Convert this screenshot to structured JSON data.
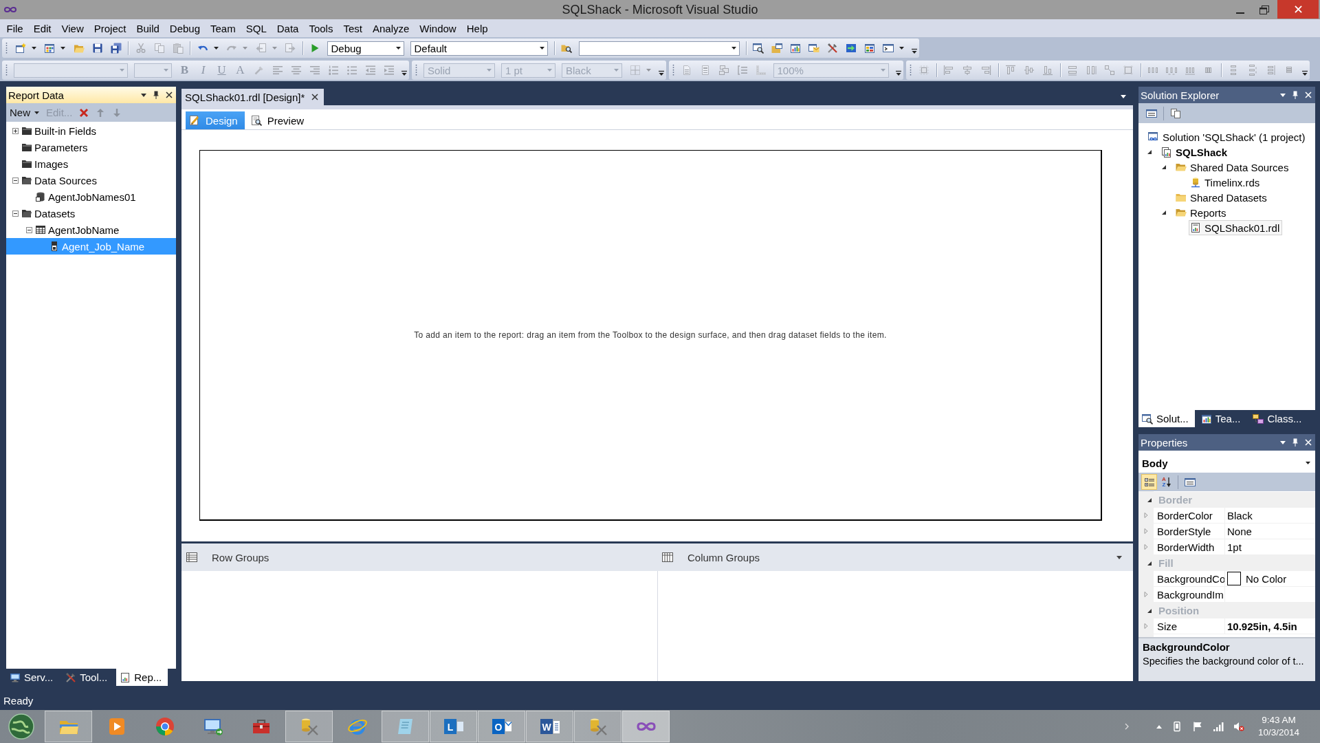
{
  "window": {
    "title": "SQLShack - Microsoft Visual Studio"
  },
  "menu": [
    "File",
    "Edit",
    "View",
    "Project",
    "Build",
    "Debug",
    "Team",
    "SQL",
    "Data",
    "Tools",
    "Test",
    "Analyze",
    "Window",
    "Help"
  ],
  "toolbar_rows": [
    [
      {
        "groups": [
          [
            {
              "kind": "split",
              "disabled": false
            },
            {
              "kind": "split",
              "disabled": false
            },
            {
              "kind": "button",
              "disabled": false
            },
            {
              "kind": "button",
              "disabled": false
            },
            {
              "kind": "button",
              "disabled": false
            }
          ],
          [
            {
              "kind": "button",
              "disabled": true
            },
            {
              "kind": "button",
              "disabled": true
            },
            {
              "kind": "button",
              "disabled": true
            }
          ],
          [
            {
              "kind": "split",
              "disabled": false
            },
            {
              "kind": "split",
              "disabled": true
            },
            {
              "kind": "split",
              "disabled": true
            },
            {
              "kind": "button",
              "disabled": true
            }
          ],
          [
            {
              "kind": "button",
              "disabled": false
            },
            {
              "kind": "combo",
              "value": "Debug",
              "disabled": false
            },
            {
              "kind": "combo",
              "value": "Default",
              "disabled": false
            }
          ],
          [
            {
              "kind": "button",
              "disabled": false
            },
            {
              "kind": "combo",
              "disabled": false
            }
          ],
          [
            {
              "kind": "button",
              "disabled": false
            },
            {
              "kind": "button",
              "disabled": false
            },
            {
              "kind": "button",
              "disabled": false
            },
            {
              "kind": "button",
              "disabled": false
            },
            {
              "kind": "button",
              "disabled": false
            },
            {
              "kind": "button",
              "disabled": false
            },
            {
              "kind": "button",
              "disabled": false
            },
            {
              "kind": "split",
              "disabled": false
            }
          ]
        ]
      }
    ],
    [
      {
        "groups": [
          [
            {
              "kind": "combo",
              "disabled": true
            },
            {
              "kind": "combo",
              "disabled": true
            },
            {
              "kind": "text",
              "label": "B",
              "disabled": true
            },
            {
              "kind": "text",
              "label": "I",
              "disabled": true
            },
            {
              "kind": "text",
              "label": "U",
              "disabled": true
            },
            {
              "kind": "text",
              "label": "A",
              "disabled": true
            },
            {
              "kind": "button",
              "disabled": true
            },
            {
              "kind": "button",
              "disabled": true
            },
            {
              "kind": "button",
              "disabled": true
            },
            {
              "kind": "button",
              "disabled": true
            },
            {
              "kind": "button",
              "disabled": true
            },
            {
              "kind": "button",
              "disabled": true
            },
            {
              "kind": "button",
              "disabled": true
            },
            {
              "kind": "button",
              "disabled": true
            }
          ]
        ]
      },
      {
        "groups": [
          [
            {
              "kind": "combo",
              "value": "Solid",
              "disabled": true
            },
            {
              "kind": "combo",
              "value": "1 pt",
              "disabled": true
            },
            {
              "kind": "combo",
              "value": "Black",
              "disabled": true
            },
            {
              "kind": "split",
              "disabled": true
            }
          ]
        ]
      },
      {
        "groups": [
          [
            {
              "kind": "button",
              "disabled": true
            },
            {
              "kind": "button",
              "disabled": true
            },
            {
              "kind": "button",
              "disabled": true
            },
            {
              "kind": "button",
              "disabled": true
            },
            {
              "kind": "button",
              "disabled": true
            },
            {
              "kind": "combo",
              "value": "100%",
              "disabled": true
            }
          ]
        ]
      },
      {
        "groups": [
          [
            {
              "kind": "button",
              "disabled": true
            }
          ],
          [
            {
              "kind": "button",
              "disabled": true
            },
            {
              "kind": "button",
              "disabled": true
            },
            {
              "kind": "button",
              "disabled": true
            }
          ],
          [
            {
              "kind": "button",
              "disabled": true
            },
            {
              "kind": "button",
              "disabled": true
            },
            {
              "kind": "button",
              "disabled": true
            }
          ],
          [
            {
              "kind": "button",
              "disabled": true
            },
            {
              "kind": "button",
              "disabled": true
            },
            {
              "kind": "button",
              "disabled": true
            },
            {
              "kind": "button",
              "disabled": true
            }
          ],
          [
            {
              "kind": "button",
              "disabled": true
            },
            {
              "kind": "button",
              "disabled": true
            },
            {
              "kind": "button",
              "disabled": true
            },
            {
              "kind": "button",
              "disabled": true
            }
          ],
          [
            {
              "kind": "button",
              "disabled": true
            },
            {
              "kind": "button",
              "disabled": true
            },
            {
              "kind": "button",
              "disabled": true
            },
            {
              "kind": "button",
              "disabled": true
            }
          ]
        ]
      }
    ]
  ],
  "report_data": {
    "title": "Report Data",
    "active": true,
    "toolbar": [
      {
        "kind": "menu",
        "label": "New",
        "disabled": false
      },
      {
        "kind": "command",
        "label": "Edit...",
        "disabled": true
      },
      {
        "kind": "delete",
        "disabled": false
      },
      {
        "kind": "move-up",
        "disabled": true
      },
      {
        "kind": "move-down",
        "disabled": true
      }
    ],
    "tree": [
      {
        "label": "Built-in Fields",
        "kind": "folder",
        "expanded": false,
        "selected": false
      },
      {
        "label": "Parameters",
        "kind": "folder",
        "selected": false
      },
      {
        "label": "Images",
        "kind": "folder",
        "selected": false
      },
      {
        "label": "Data Sources",
        "kind": "folder",
        "expanded": true,
        "selected": false,
        "children": [
          {
            "label": "AgentJobNames01",
            "kind": "data-source",
            "selected": false
          }
        ]
      },
      {
        "label": "Datasets",
        "kind": "folder",
        "expanded": true,
        "selected": false,
        "children": [
          {
            "label": "AgentJobName",
            "kind": "dataset",
            "expanded": true,
            "selected": false,
            "children": [
              {
                "label": "Agent_Job_Name",
                "kind": "field",
                "selected": true
              }
            ]
          }
        ]
      }
    ],
    "tabs": [
      {
        "label": "Serv...",
        "selected": false
      },
      {
        "label": "Tool...",
        "selected": false
      },
      {
        "label": "Rep...",
        "selected": true
      }
    ]
  },
  "document": {
    "tabs": [
      {
        "label": "SQLShack01.rdl [Design]*",
        "selected": true
      }
    ],
    "views": [
      {
        "label": "Design",
        "selected": true
      },
      {
        "label": "Preview",
        "selected": false
      }
    ],
    "hint": "To add an item to the report: drag an item from the Toolbox to the design surface, and then drag dataset fields to the item.",
    "groups": [
      {
        "label": "Row Groups"
      },
      {
        "label": "Column Groups"
      }
    ]
  },
  "solution_explorer": {
    "title": "Solution Explorer",
    "active": false,
    "tree": [
      {
        "label": "Solution 'SQLShack' (1 project)",
        "kind": "solution",
        "selected": false,
        "children": [
          {
            "label": "SQLShack",
            "kind": "project",
            "expanded": true,
            "selected": false,
            "children": [
              {
                "label": "Shared Data Sources",
                "kind": "folder",
                "expanded": true,
                "selected": false,
                "children": [
                  {
                    "label": "Timelinx.rds",
                    "kind": "data-source",
                    "selected": false
                  }
                ]
              },
              {
                "label": "Shared Datasets",
                "kind": "folder",
                "selected": false
              },
              {
                "label": "Reports",
                "kind": "folder",
                "expanded": true,
                "selected": false,
                "children": [
                  {
                    "label": "SQLShack01.rdl",
                    "kind": "report",
                    "selected": true
                  }
                ]
              }
            ]
          }
        ]
      }
    ],
    "tabs": [
      {
        "label": "Solut...",
        "selected": true
      },
      {
        "label": "Tea...",
        "selected": false
      },
      {
        "label": "Class...",
        "selected": false
      }
    ]
  },
  "properties": {
    "title": "Properties",
    "active": false,
    "object": "Body",
    "tools": [
      {
        "selected": true
      },
      {
        "selected": false,
        "glyphs": [
          "A",
          "Z"
        ]
      },
      {
        "selected": false
      }
    ],
    "categories": [
      {
        "name": "Border",
        "expanded": true,
        "items": [
          {
            "name": "BorderColor",
            "kind": "text",
            "value": "Black",
            "expanded": false,
            "modified": false
          },
          {
            "name": "BorderStyle",
            "kind": "text",
            "value": "None",
            "expanded": false,
            "modified": false
          },
          {
            "name": "BorderWidth",
            "kind": "text",
            "value": "1pt",
            "expanded": false,
            "modified": false
          }
        ]
      },
      {
        "name": "Fill",
        "expanded": true,
        "items": [
          {
            "name": "BackgroundCo",
            "kind": "color",
            "value": "No Color",
            "modified": false
          },
          {
            "name": "BackgroundIm",
            "kind": "text",
            "expanded": false
          }
        ]
      },
      {
        "name": "Position",
        "expanded": true,
        "items": [
          {
            "name": "Size",
            "kind": "text",
            "value": "10.925in, 4.5in",
            "expanded": false,
            "modified": true
          }
        ]
      }
    ],
    "description": {
      "title": "BackgroundColor",
      "text": "Specifies the background color of t..."
    }
  },
  "status_bar": {
    "text": "Ready"
  },
  "taskbar": {
    "apps": [
      {
        "running": true,
        "selected": false
      },
      {
        "running": false,
        "selected": false
      },
      {
        "running": false,
        "selected": false
      },
      {
        "running": false,
        "selected": false
      },
      {
        "running": false,
        "selected": false
      },
      {
        "running": true,
        "selected": false
      },
      {
        "running": false,
        "selected": false
      },
      {
        "running": true,
        "selected": false
      },
      {
        "running": true,
        "selected": false,
        "glyph": "L"
      },
      {
        "running": true,
        "selected": false,
        "glyph": "O"
      },
      {
        "running": true,
        "selected": false,
        "glyph": "W"
      },
      {
        "running": true,
        "selected": false
      },
      {
        "running": true,
        "selected": true
      }
    ],
    "muted": true,
    "clock": {
      "time": "9:43 AM",
      "date": "10/3/2014"
    }
  }
}
